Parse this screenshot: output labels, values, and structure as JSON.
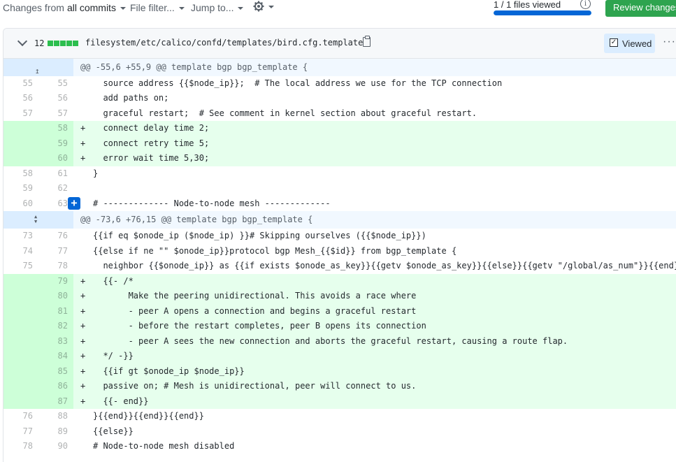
{
  "toolbar": {
    "changes_label": "Changes from",
    "changes_value": "all commits",
    "file_filter": "File filter...",
    "jump_to": "Jump to...",
    "settings_icon": "gear-icon",
    "files_viewed": "1 / 1 files viewed",
    "files_viewed_fraction": 1.0,
    "review_button": "Review changes"
  },
  "file": {
    "changes_count": "12",
    "path": "filesystem/etc/calico/confd/templates/bird.cfg.template",
    "viewed_label": "Viewed",
    "viewed_checked": "✓",
    "more": "···"
  },
  "diff": {
    "rows": [
      {
        "type": "hunk",
        "expand": "up",
        "text": "@@ -55,6 +55,9 @@ template bgp bgp_template {"
      },
      {
        "type": "ctx",
        "old": "55",
        "new": "55",
        "marker": "",
        "text": "  source address {{$node_ip}};  # The local address we use for the TCP connection"
      },
      {
        "type": "ctx",
        "old": "56",
        "new": "56",
        "marker": "",
        "text": "  add paths on;"
      },
      {
        "type": "ctx",
        "old": "57",
        "new": "57",
        "marker": "",
        "text": "  graceful restart;  # See comment in kernel section about graceful restart."
      },
      {
        "type": "add",
        "old": "",
        "new": "58",
        "marker": "+",
        "text": "  connect delay time 2;"
      },
      {
        "type": "add",
        "old": "",
        "new": "59",
        "marker": "+",
        "text": "  connect retry time 5;"
      },
      {
        "type": "add",
        "old": "",
        "new": "60",
        "marker": "+",
        "text": "  error wait time 5,30;"
      },
      {
        "type": "ctx",
        "old": "58",
        "new": "61",
        "marker": "",
        "text": "}"
      },
      {
        "type": "ctx",
        "old": "59",
        "new": "62",
        "marker": "",
        "text": ""
      },
      {
        "type": "ctx",
        "old": "60",
        "new": "63",
        "marker": "",
        "text": "# ------------- Node-to-node mesh -------------",
        "plus": true
      },
      {
        "type": "hunk",
        "expand": "both",
        "text": "@@ -73,6 +76,15 @@ template bgp bgp_template {"
      },
      {
        "type": "ctx",
        "old": "73",
        "new": "76",
        "marker": "",
        "text": "{{if eq $onode_ip ($node_ip) }}# Skipping ourselves ({{$node_ip}})"
      },
      {
        "type": "ctx",
        "old": "74",
        "new": "77",
        "marker": "",
        "text": "{{else if ne \"\" $onode_ip}}protocol bgp Mesh_{{$id}} from bgp_template {"
      },
      {
        "type": "ctx",
        "old": "75",
        "new": "78",
        "marker": "",
        "text": "  neighbor {{$onode_ip}} as {{if exists $onode_as_key}}{{getv $onode_as_key}}{{else}}{{getv \"/global/as_num\"}}{{end}};"
      },
      {
        "type": "add",
        "old": "",
        "new": "79",
        "marker": "+",
        "text": "  {{- /*"
      },
      {
        "type": "add",
        "old": "",
        "new": "80",
        "marker": "+",
        "text": "       Make the peering unidirectional. This avoids a race where"
      },
      {
        "type": "add",
        "old": "",
        "new": "81",
        "marker": "+",
        "text": "       - peer A opens a connection and begins a graceful restart"
      },
      {
        "type": "add",
        "old": "",
        "new": "82",
        "marker": "+",
        "text": "       - before the restart completes, peer B opens its connection"
      },
      {
        "type": "add",
        "old": "",
        "new": "83",
        "marker": "+",
        "text": "       - peer A sees the new connection and aborts the graceful restart, causing a route flap."
      },
      {
        "type": "add",
        "old": "",
        "new": "84",
        "marker": "+",
        "text": "  */ -}}"
      },
      {
        "type": "add",
        "old": "",
        "new": "85",
        "marker": "+",
        "text": "  {{if gt $onode_ip $node_ip}}"
      },
      {
        "type": "add",
        "old": "",
        "new": "86",
        "marker": "+",
        "text": "  passive on; # Mesh is unidirectional, peer will connect to us."
      },
      {
        "type": "add",
        "old": "",
        "new": "87",
        "marker": "+",
        "text": "  {{- end}}"
      },
      {
        "type": "ctx",
        "old": "76",
        "new": "88",
        "marker": "",
        "text": "}{{end}}{{end}}{{end}}"
      },
      {
        "type": "ctx",
        "old": "77",
        "new": "89",
        "marker": "",
        "text": "{{else}}"
      },
      {
        "type": "ctx",
        "old": "78",
        "new": "90",
        "marker": "",
        "text": "# Node-to-node mesh disabled"
      }
    ]
  }
}
